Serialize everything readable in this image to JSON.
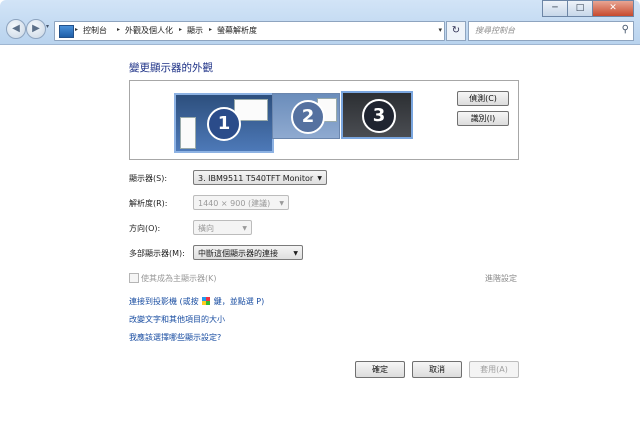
{
  "window": {
    "caption_minimize": "─",
    "caption_maximize": "□",
    "caption_close": "✕"
  },
  "nav": {
    "back_glyph": "◀",
    "forward_glyph": "▶",
    "dropdown_glyph": "▾",
    "breadcrumbs": [
      "控制台",
      "外觀及個人化",
      "顯示",
      "螢幕解析度"
    ],
    "crumb_separator": "▸",
    "refresh_glyph": "↻",
    "search_placeholder": "搜尋控制台",
    "search_icon": "search-icon"
  },
  "main": {
    "heading": "變更顯示器的外觀",
    "monitors": [
      "1",
      "2",
      "3"
    ],
    "detect_button": "偵測(C)",
    "identify_button": "識別(I)"
  },
  "settings": {
    "display_label": "顯示器(S):",
    "display_value": "3. IBM9511 T540TFT Monitor",
    "resolution_label": "解析度(R):",
    "resolution_value": "1440 × 900 (建議)",
    "orientation_label": "方向(O):",
    "orientation_value": "橫向",
    "multi_label": "多部顯示器(M):",
    "multi_value": "中斷這個顯示器的連接",
    "primary_checkbox_label": "使其成為主顯示器(K)",
    "advanced_link": "進階設定"
  },
  "links": {
    "projector_prefix": "連接到投影機 (或按",
    "projector_suffix": "鍵，並點選 P)",
    "text_size": "改變文字和其他項目的大小",
    "which_settings": "我應該選擇哪些顯示設定?"
  },
  "buttons": {
    "ok": "確定",
    "cancel": "取消",
    "apply": "套用(A)"
  }
}
